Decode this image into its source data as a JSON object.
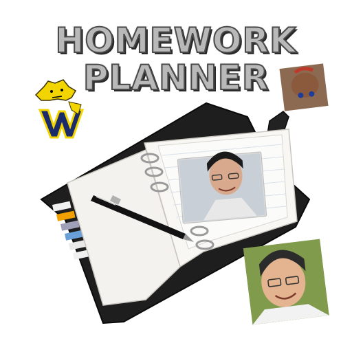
{
  "title": {
    "line1": "HOMEWORK",
    "line2": "PLANNER"
  },
  "icons": {
    "mascot": "wildcat-w-logo",
    "planner": "open-planner-icon",
    "pen": "pen-icon"
  },
  "colors": {
    "title_fill": "#b9b9b9",
    "title_outline": "#4a4a4a",
    "planner_cover": "#1e1e1e",
    "page": "#f4f2ee",
    "mascot_yellow": "#f2d400",
    "mascot_navy": "#1b2a6b"
  }
}
